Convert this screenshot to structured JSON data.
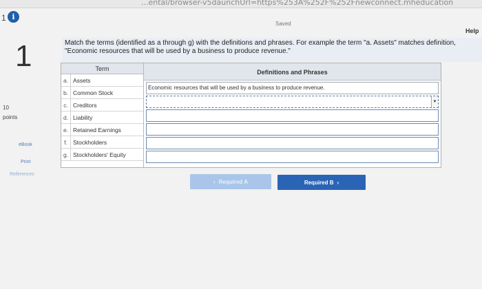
{
  "browser": {
    "url_fragment": "...ental/browser-v5daunchUrl=https%253A%252F%252Fnewconnect.mheducation"
  },
  "header": {
    "question_number": "1",
    "info_icon": "info-icon",
    "saved_label": "Saved",
    "help_label": "Help"
  },
  "sidebar": {
    "question_big_number": "1",
    "points_value": "10",
    "points_label": "points",
    "links": {
      "ebook": "eBook",
      "print": "Print",
      "references": "References"
    }
  },
  "instructions": "Match the terms (identified as a through g) with the definitions and phrases. For example the term \"a. Assets\" matches definition, \"Economic resources that will be used by a business to produce revenue.\"",
  "table": {
    "term_header": "Term",
    "definitions_header": "Definitions and Phrases",
    "terms": [
      {
        "letter": "a.",
        "text": "Assets"
      },
      {
        "letter": "b.",
        "text": "Common Stock"
      },
      {
        "letter": "c.",
        "text": "Creditors"
      },
      {
        "letter": "d.",
        "text": "Liability"
      },
      {
        "letter": "e.",
        "text": "Retained Earnings"
      },
      {
        "letter": "f.",
        "text": "Stockholders"
      },
      {
        "letter": "g.",
        "text": "Stockholders' Equity"
      }
    ],
    "definitions": [
      {
        "value": "Economic resources that will be used by a business to produce revenue."
      },
      {
        "value": ""
      },
      {
        "value": ""
      },
      {
        "value": ""
      },
      {
        "value": ""
      },
      {
        "value": ""
      }
    ]
  },
  "navigation": {
    "prev_label": "Required A",
    "prev_arrow": "‹",
    "next_label": "Required B",
    "next_arrow": "›"
  },
  "colors": {
    "accent": "#2a64b5",
    "instructions_bg": "#e8eef4",
    "header_bg": "#e0e6ec"
  }
}
